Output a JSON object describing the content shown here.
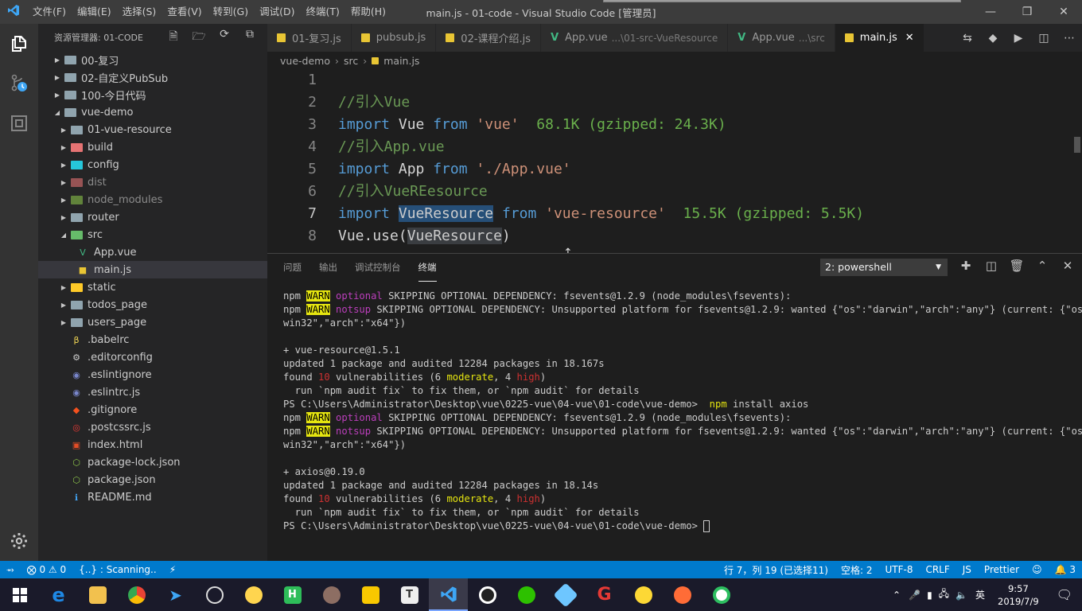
{
  "titlebar": {
    "menu": [
      "文件(F)",
      "编辑(E)",
      "选择(S)",
      "查看(V)",
      "转到(G)",
      "调试(D)",
      "终端(T)",
      "帮助(H)"
    ],
    "title": "main.js - 01-code - Visual Studio Code [管理员]"
  },
  "sidebar": {
    "title": "资源管理器: 01-CODE",
    "tree": [
      {
        "label": "00-复习",
        "depth": 0,
        "kind": "folder",
        "open": false
      },
      {
        "label": "02-自定义PubSub",
        "depth": 0,
        "kind": "folder",
        "open": false
      },
      {
        "label": "100-今日代码",
        "depth": 0,
        "kind": "folder",
        "open": false
      },
      {
        "label": "vue-demo",
        "depth": 0,
        "kind": "folder",
        "open": true
      },
      {
        "label": "01-vue-resource",
        "depth": 1,
        "kind": "folder",
        "open": false
      },
      {
        "label": "build",
        "depth": 1,
        "kind": "folder-build",
        "open": false
      },
      {
        "label": "config",
        "depth": 1,
        "kind": "folder-config",
        "open": false
      },
      {
        "label": "dist",
        "depth": 1,
        "kind": "folder-dist",
        "open": false,
        "dim": true
      },
      {
        "label": "node_modules",
        "depth": 1,
        "kind": "folder-node",
        "open": false,
        "dim": true
      },
      {
        "label": "router",
        "depth": 1,
        "kind": "folder",
        "open": false
      },
      {
        "label": "src",
        "depth": 1,
        "kind": "folder-src",
        "open": true
      },
      {
        "label": "App.vue",
        "depth": 2,
        "kind": "vue"
      },
      {
        "label": "main.js",
        "depth": 2,
        "kind": "js",
        "active": true
      },
      {
        "label": "static",
        "depth": 1,
        "kind": "folder-static",
        "open": false
      },
      {
        "label": "todos_page",
        "depth": 1,
        "kind": "folder",
        "open": false
      },
      {
        "label": "users_page",
        "depth": 1,
        "kind": "folder",
        "open": false
      },
      {
        "label": ".babelrc",
        "depth": 1,
        "kind": "babel"
      },
      {
        "label": ".editorconfig",
        "depth": 1,
        "kind": "gear"
      },
      {
        "label": ".eslintignore",
        "depth": 1,
        "kind": "eslint"
      },
      {
        "label": ".eslintrc.js",
        "depth": 1,
        "kind": "eslint"
      },
      {
        "label": ".gitignore",
        "depth": 1,
        "kind": "git"
      },
      {
        "label": ".postcssrc.js",
        "depth": 1,
        "kind": "postcss"
      },
      {
        "label": "index.html",
        "depth": 1,
        "kind": "html"
      },
      {
        "label": "package-lock.json",
        "depth": 1,
        "kind": "npm"
      },
      {
        "label": "package.json",
        "depth": 1,
        "kind": "npm"
      },
      {
        "label": "README.md",
        "depth": 1,
        "kind": "info"
      }
    ]
  },
  "tabs": [
    {
      "label": "01-复习.js",
      "icon": "js",
      "sub": ""
    },
    {
      "label": "pubsub.js",
      "icon": "js",
      "sub": ""
    },
    {
      "label": "02-课程介绍.js",
      "icon": "js",
      "sub": ""
    },
    {
      "label": "App.vue",
      "icon": "vue",
      "sub": "...\\01-src-VueResource"
    },
    {
      "label": "App.vue",
      "icon": "vue",
      "sub": "...\\src"
    },
    {
      "label": "main.js",
      "icon": "js",
      "sub": "",
      "active": true
    }
  ],
  "breadcrumb": [
    "vue-demo",
    "src",
    "main.js"
  ],
  "code_lines": [
    {
      "n": "1",
      "parts": []
    },
    {
      "n": "2",
      "parts": [
        [
          "cm",
          "//引入Vue"
        ]
      ]
    },
    {
      "n": "3",
      "parts": [
        [
          "kw",
          "import"
        ],
        [
          "id",
          " Vue "
        ],
        [
          "kw",
          "from"
        ],
        [
          "st",
          " 'vue'"
        ],
        [
          "hint",
          "  68.1K (gzipped: 24.3K)"
        ]
      ]
    },
    {
      "n": "4",
      "parts": [
        [
          "cm",
          "//引入App.vue"
        ]
      ]
    },
    {
      "n": "5",
      "parts": [
        [
          "kw",
          "import"
        ],
        [
          "id",
          " App "
        ],
        [
          "kw",
          "from"
        ],
        [
          "st",
          " './App.vue'"
        ]
      ]
    },
    {
      "n": "6",
      "parts": [
        [
          "cm",
          "//引入VueREesource"
        ]
      ]
    },
    {
      "n": "7",
      "cur": true,
      "parts": [
        [
          "kw",
          "import"
        ],
        [
          "id",
          " "
        ],
        [
          "sel",
          "VueResource"
        ],
        [
          "id",
          " "
        ],
        [
          "kw",
          "from"
        ],
        [
          "st",
          " 'vue-resource'"
        ],
        [
          "hint",
          "  15.5K (gzipped: 5.5K)"
        ]
      ]
    },
    {
      "n": "8",
      "parts": [
        [
          "id",
          "Vue.use("
        ],
        [
          "selhl",
          "VueResource"
        ],
        [
          "id",
          ")"
        ]
      ]
    }
  ],
  "panel": {
    "tabs": [
      "问题",
      "输出",
      "调试控制台",
      "终端"
    ],
    "active_tab": "终端",
    "terminal_select": "2: powershell"
  },
  "terminal_lines": [
    [
      [
        "",
        "npm "
      ],
      [
        "warn",
        "WARN"
      ],
      [
        "mag",
        " optional"
      ],
      [
        "",
        " SKIPPING OPTIONAL DEPENDENCY: fsevents@1.2.9 (node_modules\\fsevents):"
      ]
    ],
    [
      [
        "",
        "npm "
      ],
      [
        "warn",
        "WARN"
      ],
      [
        "mag",
        " notsup"
      ],
      [
        "",
        " SKIPPING OPTIONAL DEPENDENCY: Unsupported platform for fsevents@1.2.9: wanted {\"os\":\"darwin\",\"arch\":\"any\"} (current: {\"os\":\""
      ]
    ],
    [
      [
        "",
        "win32\",\"arch\":\"x64\"})"
      ]
    ],
    [
      [
        "",
        ""
      ]
    ],
    [
      [
        "",
        "+ vue-resource@1.5.1"
      ]
    ],
    [
      [
        "",
        "updated 1 package and audited 12284 packages in 18.167s"
      ]
    ],
    [
      [
        "",
        "found "
      ],
      [
        "red",
        "10"
      ],
      [
        "",
        " vulnerabilities (6 "
      ],
      [
        "yel",
        "moderate"
      ],
      [
        "",
        ", 4 "
      ],
      [
        "red",
        "high"
      ],
      [
        "",
        ")"
      ]
    ],
    [
      [
        "",
        "  run `npm audit fix` to fix them, or `npm audit` for details"
      ]
    ],
    [
      [
        "",
        "PS C:\\Users\\Administrator\\Desktop\\vue\\0225-vue\\04-vue\\01-code\\vue-demo>  "
      ],
      [
        "yel",
        "npm"
      ],
      [
        "",
        " install axios"
      ]
    ],
    [
      [
        "",
        "npm "
      ],
      [
        "warn",
        "WARN"
      ],
      [
        "mag",
        " optional"
      ],
      [
        "",
        " SKIPPING OPTIONAL DEPENDENCY: fsevents@1.2.9 (node_modules\\fsevents):"
      ]
    ],
    [
      [
        "",
        "npm "
      ],
      [
        "warn",
        "WARN"
      ],
      [
        "mag",
        " notsup"
      ],
      [
        "",
        " SKIPPING OPTIONAL DEPENDENCY: Unsupported platform for fsevents@1.2.9: wanted {\"os\":\"darwin\",\"arch\":\"any\"} (current: {\"os\":\""
      ]
    ],
    [
      [
        "",
        "win32\",\"arch\":\"x64\"})"
      ]
    ],
    [
      [
        "",
        ""
      ]
    ],
    [
      [
        "",
        "+ axios@0.19.0"
      ]
    ],
    [
      [
        "",
        "updated 1 package and audited 12284 packages in 18.14s"
      ]
    ],
    [
      [
        "",
        "found "
      ],
      [
        "red",
        "10"
      ],
      [
        "",
        " vulnerabilities (6 "
      ],
      [
        "yel",
        "moderate"
      ],
      [
        "",
        ", 4 "
      ],
      [
        "red",
        "high"
      ],
      [
        "",
        ")"
      ]
    ],
    [
      [
        "",
        "  run `npm audit fix` to fix them, or `npm audit` for details"
      ]
    ],
    [
      [
        "",
        "PS C:\\Users\\Administrator\\Desktop\\vue\\0225-vue\\04-vue\\01-code\\vue-demo> "
      ],
      [
        "cursor",
        ""
      ]
    ]
  ],
  "statusbar": {
    "errors": "0",
    "warnings": "0",
    "scanning": "{..} : Scanning..",
    "position": "行 7，列 19 (已选择11)",
    "spaces": "空格: 2",
    "encoding": "UTF-8",
    "eol": "CRLF",
    "language": "JS",
    "prettier": "Prettier",
    "notifications": "3"
  },
  "taskbar": {
    "ime": "英",
    "time": "9:57",
    "date": "2019/7/9"
  },
  "colors": {
    "accent": "#007acc",
    "titlebar": "#3c3c3c",
    "sidebar": "#252526",
    "editor": "#1e1e1e"
  }
}
